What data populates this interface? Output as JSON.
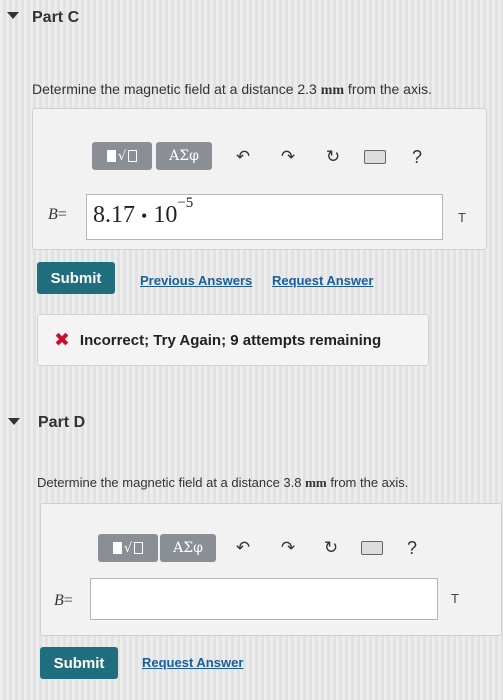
{
  "part_c": {
    "title": "Part C",
    "question_prefix": "Determine the magnetic field at a distance 2.3 ",
    "question_unit": "mm",
    "question_suffix": " from the axis.",
    "toolbar": {
      "templates_icon": "templates-icon",
      "greek_label": "ΑΣφ",
      "undo_icon": "undo-icon",
      "redo_icon": "redo-icon",
      "reset_icon": "reset-icon",
      "keyboard_icon": "keyboard-icon",
      "help_label": "?"
    },
    "variable": "B",
    "equals": "=",
    "answer_mantissa": "8.17",
    "answer_dot": "•",
    "answer_base": "10",
    "answer_exponent": "−5",
    "unit": "T",
    "submit_label": "Submit",
    "previous_answers_label": "Previous Answers",
    "request_answer_label": "Request Answer",
    "feedback": {
      "status": "incorrect",
      "text": "Incorrect; Try Again; 9 attempts remaining",
      "color": "#c8102e"
    }
  },
  "part_d": {
    "title": "Part D",
    "question_prefix": "Determine the magnetic field at a distance 3.8 ",
    "question_unit": "mm",
    "question_suffix": " from the axis.",
    "toolbar": {
      "greek_label": "ΑΣφ",
      "help_label": "?"
    },
    "variable": "B",
    "equals": "=",
    "answer_value": "",
    "unit": "T",
    "submit_label": "Submit",
    "request_answer_label": "Request Answer"
  },
  "colors": {
    "submit": "#1f6e7e",
    "link": "#1a5e9e",
    "toolbar_button": "#8a8f96"
  }
}
